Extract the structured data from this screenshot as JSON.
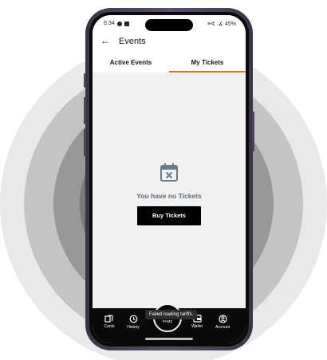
{
  "status_bar": {
    "time": "6:34",
    "right": "≡∢ .∡ 45%"
  },
  "app_bar": {
    "back_icon": "arrow-left-icon",
    "title": "Events"
  },
  "tabs": [
    {
      "label": "Active Events",
      "active": false
    },
    {
      "label": "My Tickets",
      "active": true
    }
  ],
  "empty_state": {
    "icon": "calendar-x-icon",
    "message": "You have no Tickets",
    "button_label": "Buy Tickets"
  },
  "toast": "Failed loading tariffs.",
  "bottom_nav": {
    "items": [
      {
        "label": "Cards",
        "icon": "cards-icon"
      },
      {
        "label": "History",
        "icon": "history-icon"
      },
      {
        "label": "PAMZ",
        "icon": "pamz-icon"
      },
      {
        "label": "Wallet",
        "icon": "wallet-icon"
      },
      {
        "label": "Account",
        "icon": "account-icon"
      }
    ]
  },
  "colors": {
    "accent": "#e0731f",
    "button_bg": "#000000",
    "empty_icon": "#6b7b88",
    "nav_bg": "#0a0a0a"
  }
}
